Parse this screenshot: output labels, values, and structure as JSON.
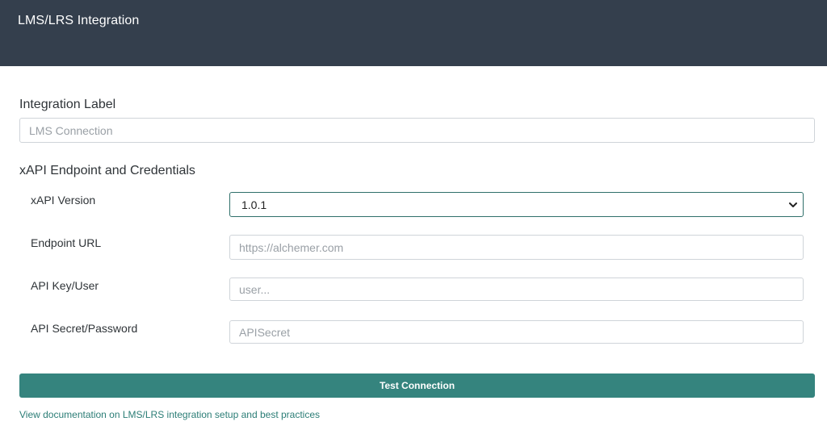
{
  "header": {
    "title": "LMS/LRS Integration"
  },
  "integration_label": {
    "label": "Integration Label",
    "placeholder": "LMS Connection",
    "value": ""
  },
  "credentials": {
    "section_title": "xAPI Endpoint and Credentials",
    "xapi_version": {
      "label": "xAPI Version",
      "selected": "1.0.1",
      "icon": "chevron-down-icon"
    },
    "endpoint_url": {
      "label": "Endpoint URL",
      "placeholder": "https://alchemer.com",
      "value": ""
    },
    "api_key": {
      "label": "API Key/User",
      "placeholder": "user...",
      "value": ""
    },
    "api_secret": {
      "label": "API Secret/Password",
      "placeholder": "APISecret",
      "value": ""
    }
  },
  "actions": {
    "test_button_label": "Test Connection",
    "doc_link_text": "View documentation on LMS/LRS integration setup and best practices"
  },
  "colors": {
    "header_bg": "#343f4d",
    "accent": "#35847e",
    "link": "#2b7d76"
  }
}
